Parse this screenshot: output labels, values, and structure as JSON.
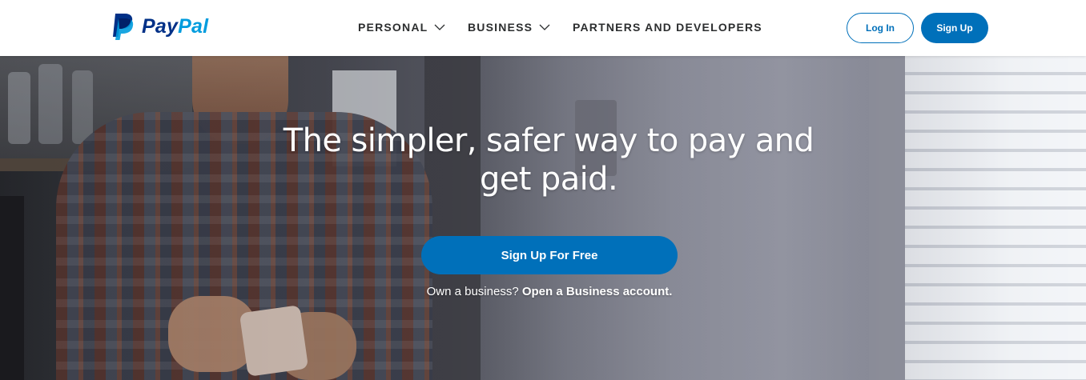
{
  "brand": {
    "logo_text_pay": "Pay",
    "logo_text_pal": "Pal",
    "colors": {
      "navy": "#003087",
      "light_blue": "#009cde",
      "button_blue": "#0070ba"
    }
  },
  "nav": {
    "items": [
      {
        "label": "PERSONAL",
        "has_dropdown": true
      },
      {
        "label": "BUSINESS",
        "has_dropdown": true
      },
      {
        "label": "PARTNERS AND DEVELOPERS",
        "has_dropdown": false
      }
    ]
  },
  "header_actions": {
    "login_label": "Log In",
    "signup_label": "Sign Up"
  },
  "hero": {
    "title": "The simpler, safer way to pay and get paid.",
    "cta_label": "Sign Up For Free",
    "business_prompt": "Own a business?",
    "business_link": "Open a Business account."
  }
}
